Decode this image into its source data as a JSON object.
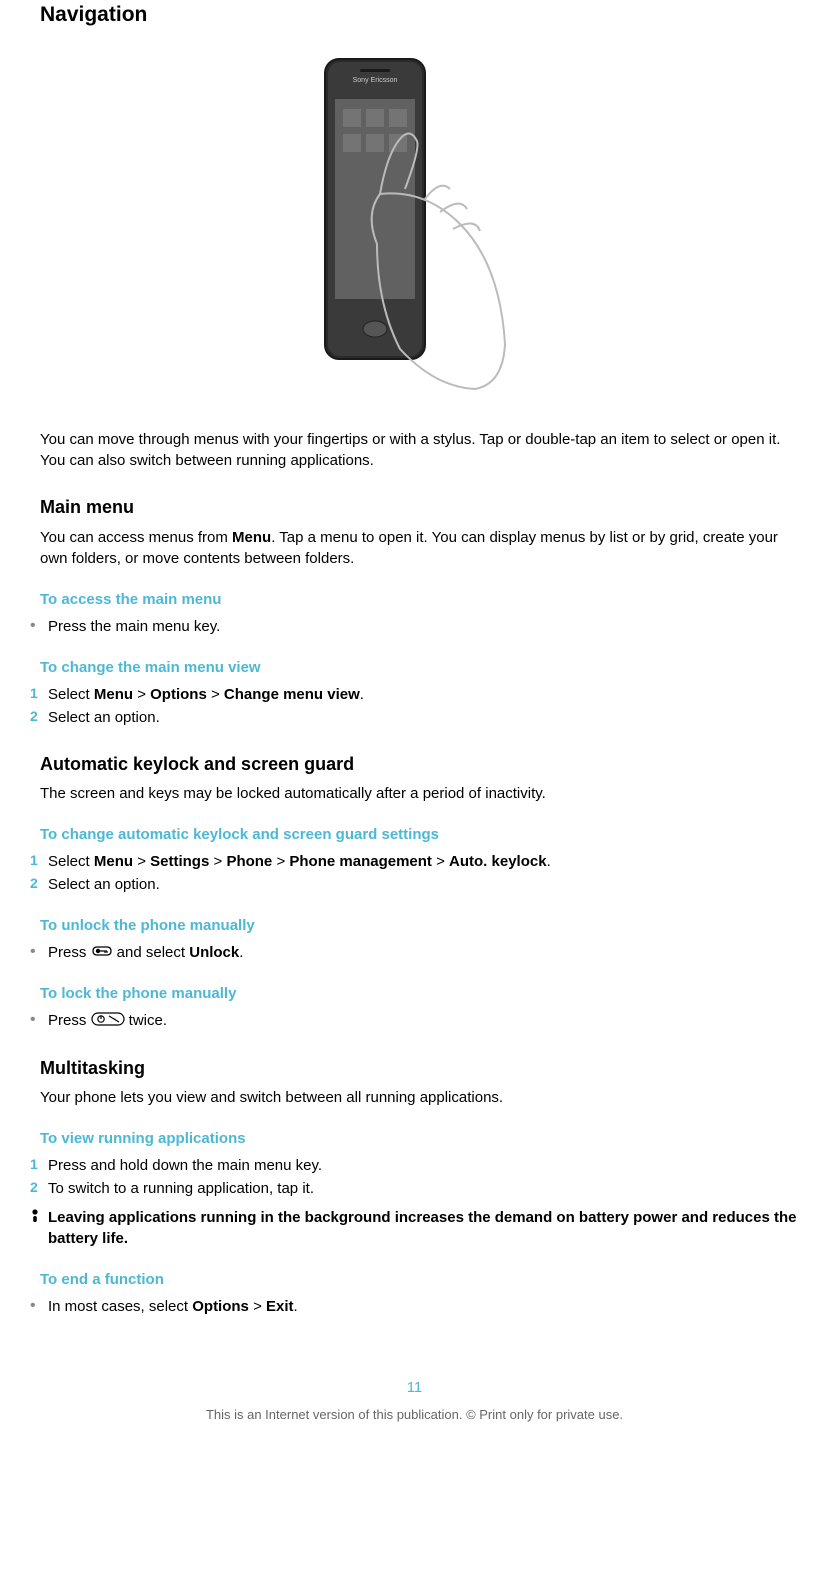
{
  "title": "Navigation",
  "intro": "You can move through menus with your fingertips or with a stylus. Tap or double-tap an item to select or open it. You can also switch between running applications.",
  "sections": {
    "main_menu": {
      "heading": "Main menu",
      "text_pre": "You can access menus from ",
      "text_bold": "Menu",
      "text_post": ". Tap a menu to open it. You can display menus by list or by grid, create your own folders, or move contents between folders.",
      "access": {
        "heading": "To access the main menu",
        "step": "Press the main menu key."
      },
      "change_view": {
        "heading": "To change the main menu view",
        "step1_pre": "Select ",
        "step1_b1": "Menu",
        "step1_sep1": " > ",
        "step1_b2": "Options",
        "step1_sep2": " > ",
        "step1_b3": "Change menu view",
        "step1_post": ".",
        "step2": "Select an option."
      }
    },
    "keylock": {
      "heading": "Automatic keylock and screen guard",
      "text": "The screen and keys may be locked automatically after a period of inactivity.",
      "change": {
        "heading": "To change automatic keylock and screen guard settings",
        "step1_pre": "Select ",
        "step1_b1": "Menu",
        "step1_sep": " > ",
        "step1_b2": "Settings",
        "step1_b3": "Phone",
        "step1_b4": "Phone management",
        "step1_b5": "Auto. keylock",
        "step1_post": ".",
        "step2": "Select an option."
      },
      "unlock": {
        "heading": "To unlock the phone manually",
        "pre": "Press ",
        "mid": " and select ",
        "bold": "Unlock",
        "post": "."
      },
      "lock": {
        "heading": "To lock the phone manually",
        "pre": "Press ",
        "post": " twice."
      }
    },
    "multitasking": {
      "heading": "Multitasking",
      "text": "Your phone lets you view and switch between all running applications.",
      "view": {
        "heading": "To view running applications",
        "step1": "Press and hold down the main menu key.",
        "step2": "To switch to a running application, tap it.",
        "warning": "Leaving applications running in the background increases the demand on battery power and reduces the battery life."
      },
      "end": {
        "heading": "To end a function",
        "pre": "In most cases, select ",
        "b1": "Options",
        "sep": " > ",
        "b2": "Exit",
        "post": "."
      }
    }
  },
  "page_number": "11",
  "footer": "This is an Internet version of this publication. © Print only for private use."
}
